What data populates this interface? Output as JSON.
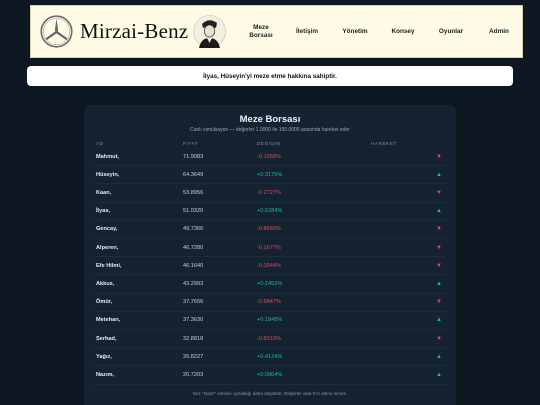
{
  "header": {
    "brand": "Mirzai-Benz",
    "nav": [
      {
        "label": "Meze\nBorsası",
        "name": "nav-meze-borsasi"
      },
      {
        "label": "İletişim",
        "name": "nav-iletisim"
      },
      {
        "label": "Yönetim",
        "name": "nav-yonetim"
      },
      {
        "label": "Konsey",
        "name": "nav-konsey"
      },
      {
        "label": "Oyunlar",
        "name": "nav-oyunlar"
      },
      {
        "label": "Admin",
        "name": "nav-admin"
      }
    ]
  },
  "notice": "İlyas, Hüseyin'yi meze etme hakkına sahiptir.",
  "market": {
    "title": "Meze Borsası",
    "subtitle": "Canlı simülasyon — değerler 1.0000 ile 100.0000 arasında hareket eder",
    "columns": {
      "name": "AD",
      "price": "FİYAT",
      "change": "DEĞİŞİM",
      "move": "HAREKET"
    },
    "rows": [
      {
        "name": "Mahmut,",
        "price": "71.9083",
        "change": "-0.1958%",
        "dir": "down"
      },
      {
        "name": "Hüseyin,",
        "price": "64.3649",
        "change": "+0.3175%",
        "dir": "up"
      },
      {
        "name": "Kaan,",
        "price": "53.8956",
        "change": "-0.2727%",
        "dir": "down"
      },
      {
        "name": "İlyas,",
        "price": "51.0320",
        "change": "+0.6284%",
        "dir": "up"
      },
      {
        "name": "Gencay,",
        "price": "49.7366",
        "change": "-0.8666%",
        "dir": "down"
      },
      {
        "name": "Alperen,",
        "price": "46.7280",
        "change": "-0.1677%",
        "dir": "down"
      },
      {
        "name": "Efe Hilmi,",
        "price": "46.1640",
        "change": "-0.3544%",
        "dir": "down"
      },
      {
        "name": "Akkus,",
        "price": "43.2993",
        "change": "+0.1452%",
        "dir": "up"
      },
      {
        "name": "Ömür,",
        "price": "37.7656",
        "change": "-0.9847%",
        "dir": "down"
      },
      {
        "name": "Metehan,",
        "price": "37.3630",
        "change": "+0.1848%",
        "dir": "up"
      },
      {
        "name": "Serhad,",
        "price": "32.8818",
        "change": "-0.8319%",
        "dir": "down"
      },
      {
        "name": "Yağız,",
        "price": "26.8227",
        "change": "+0.4124%",
        "dir": "up"
      },
      {
        "name": "Nazım,",
        "price": "20.7203",
        "change": "+0.0964%",
        "dir": "up"
      }
    ],
    "footnote": "Not: \"Nazlı\" isminin oynaklığı daha düşüktür. Değerler asla 0'ın altına inmez."
  },
  "colors": {
    "up": "#23b98a",
    "down": "#e24d4d",
    "background": "#0d1722",
    "panel": "#142231"
  },
  "icons": {
    "up": "up-triangle-icon",
    "down": "down-triangle-icon"
  }
}
